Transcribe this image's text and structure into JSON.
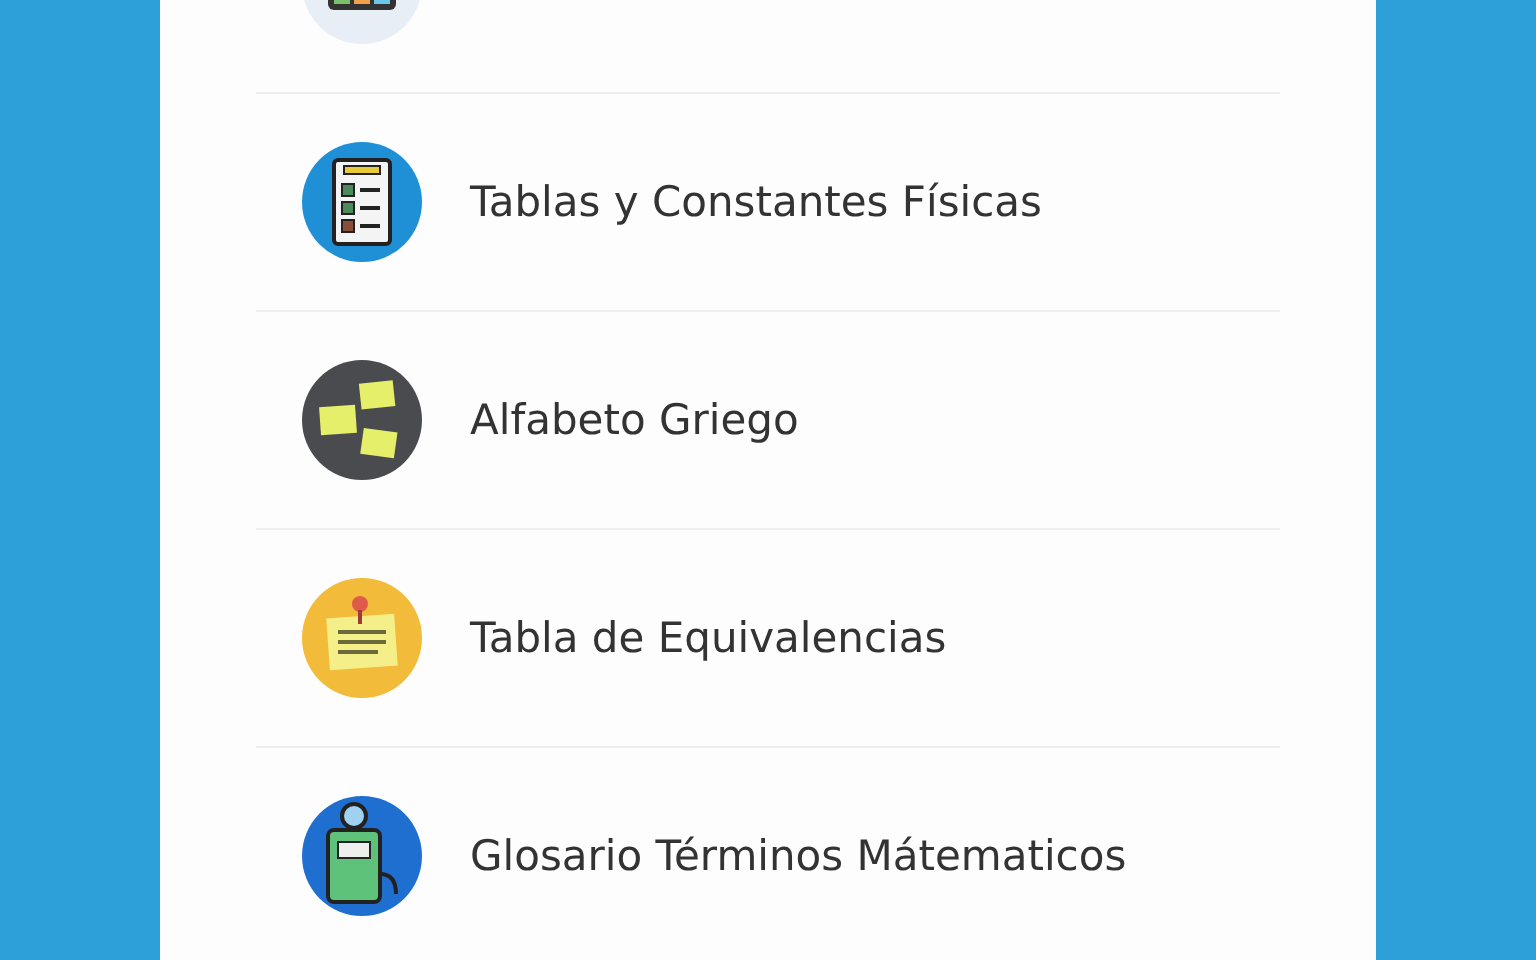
{
  "menu": {
    "items": [
      {
        "kind": "grid"
      },
      {
        "kind": "checklist",
        "label": "Tablas y Constantes Físicas"
      },
      {
        "kind": "notes",
        "label": "Alfabeto Griego"
      },
      {
        "kind": "pinned",
        "label": "Tabla de Equivalencias"
      },
      {
        "kind": "device",
        "label": "Glosario Términos Mátematicos"
      }
    ]
  }
}
